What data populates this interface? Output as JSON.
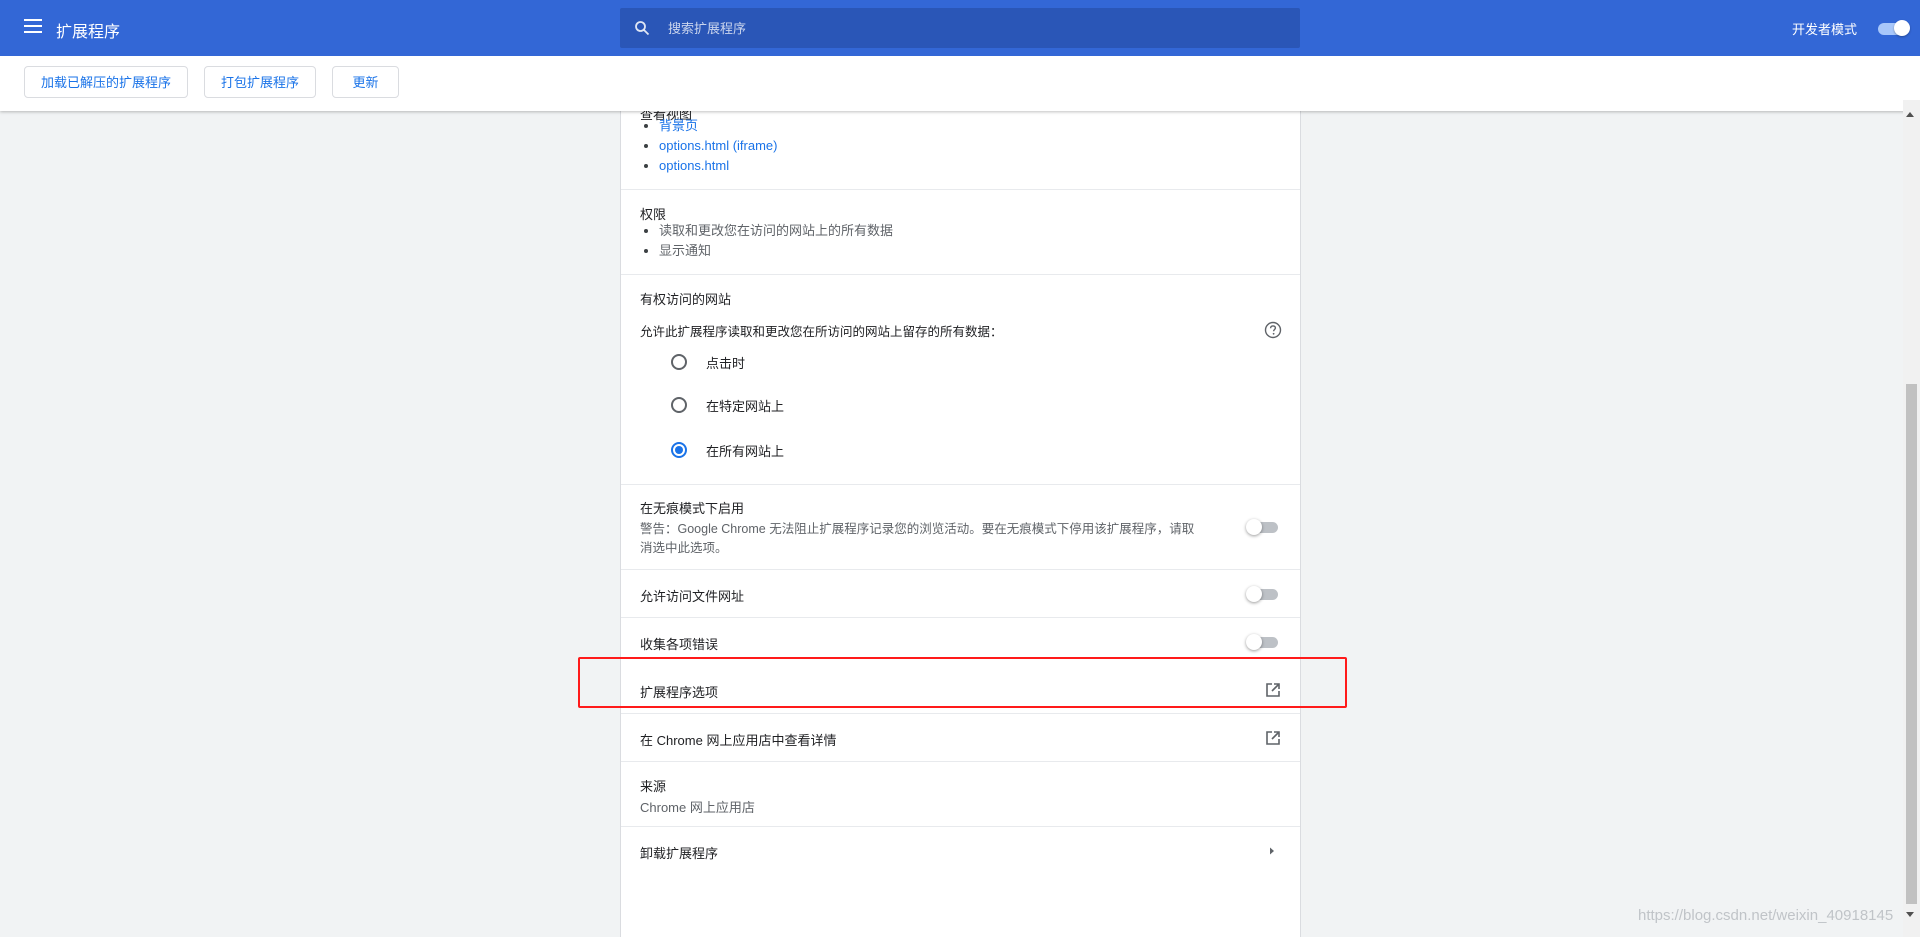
{
  "header": {
    "title": "扩展程序",
    "search_placeholder": "搜索扩展程序",
    "dev_mode_label": "开发者模式",
    "dev_mode_on": true,
    "accent": "#3367d6"
  },
  "toolbar": {
    "load_unpacked": "加载已解压的扩展程序",
    "pack": "打包扩展程序",
    "update": "更新"
  },
  "details": {
    "views_heading_partial": "查看视图",
    "views": [
      "背景页",
      "options.html (iframe)",
      "options.html"
    ],
    "permissions_title": "权限",
    "permissions": [
      "读取和更改您在访问的网站上的所有数据",
      "显示通知"
    ],
    "site_access_title": "有权访问的网站",
    "site_access_desc": "允许此扩展程序读取和更改您在所访问的网站上留存的所有数据：",
    "site_access_options": [
      {
        "label": "点击时",
        "checked": false
      },
      {
        "label": "在特定网站上",
        "checked": false
      },
      {
        "label": "在所有网站上",
        "checked": true
      }
    ],
    "incognito_title": "在无痕模式下启用",
    "incognito_warning_line1": "警告：Google Chrome 无法阻止扩展程序记录您的浏览活动。要在无痕模式下停用该扩展程序，请取",
    "incognito_warning_line2": "消选中此选项。",
    "incognito_enabled": false,
    "file_urls_title": "允许访问文件网址",
    "file_urls_enabled": false,
    "collect_errors_title": "收集各项错误",
    "collect_errors_enabled": false,
    "ext_options_title": "扩展程序选项",
    "webstore_title": "在 Chrome 网上应用店中查看详情",
    "source_title": "来源",
    "source_value": "Chrome 网上应用店",
    "remove_title": "卸载扩展程序"
  },
  "watermark": "https://blog.csdn.net/weixin_40918145"
}
